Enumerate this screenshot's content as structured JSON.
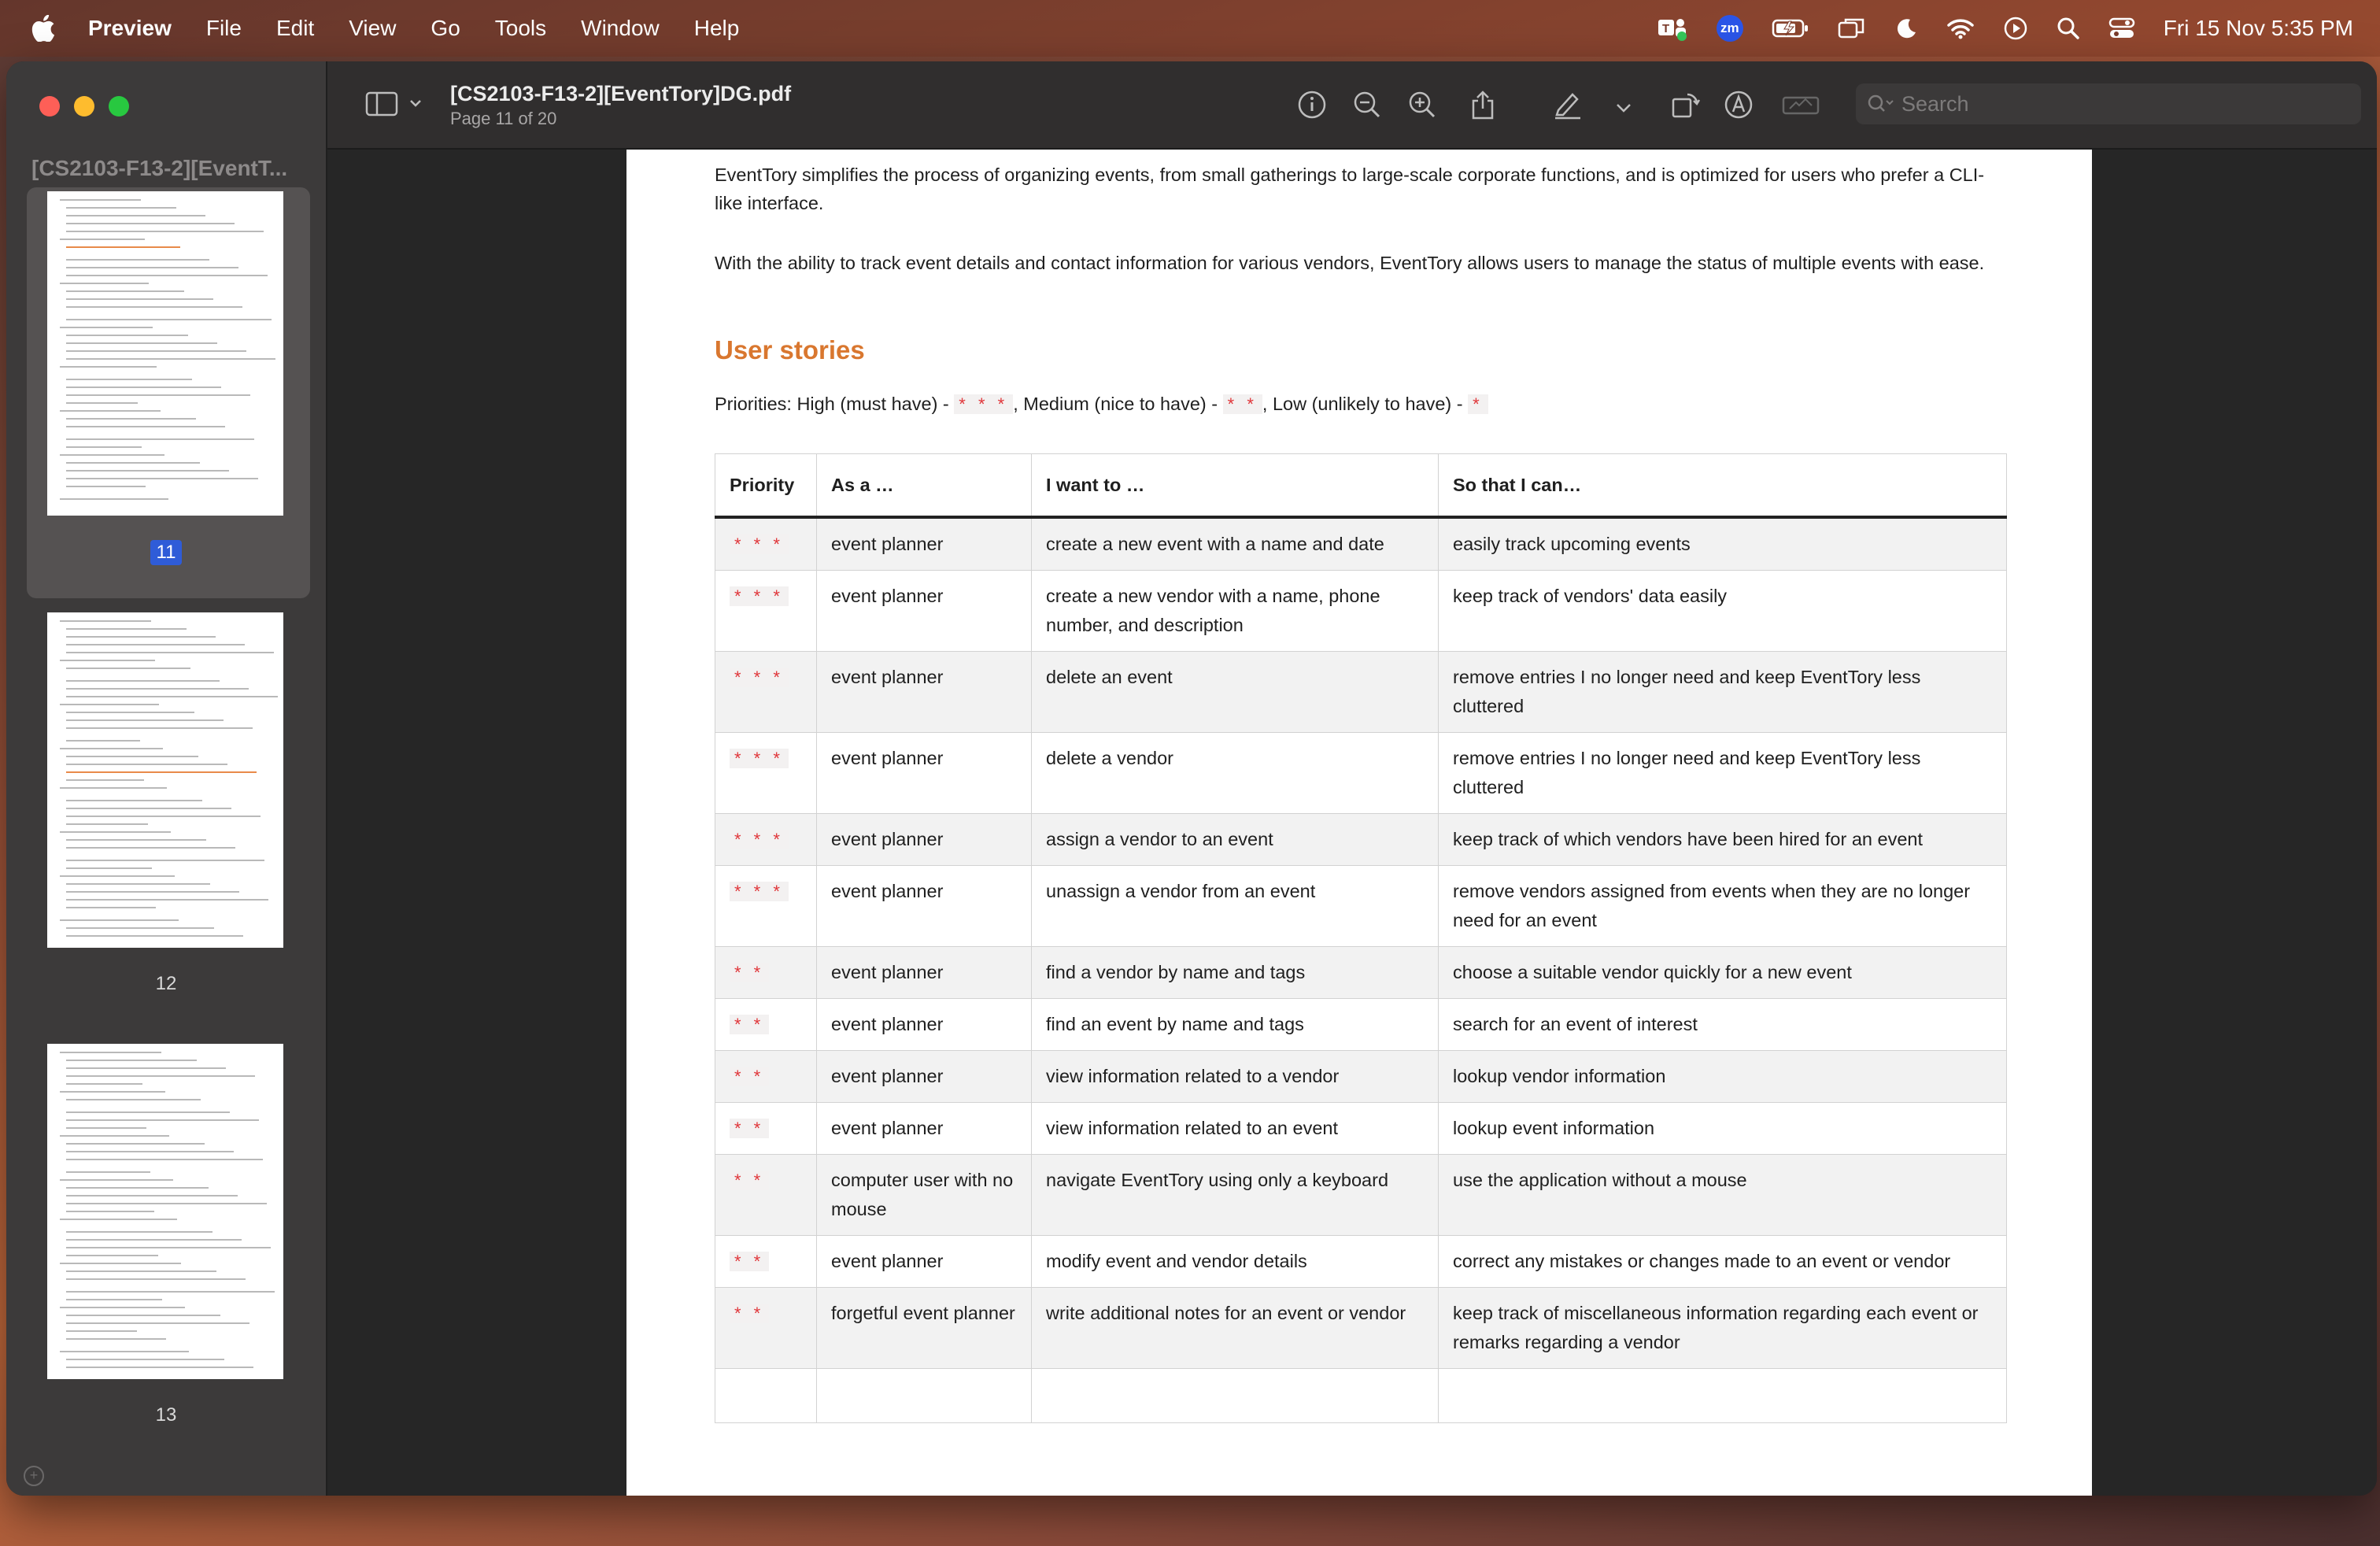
{
  "menubar": {
    "app_name": "Preview",
    "items": [
      "File",
      "Edit",
      "View",
      "Go",
      "Tools",
      "Window",
      "Help"
    ],
    "zoom_label": "zm",
    "datetime": "Fri 15 Nov  5:35 PM"
  },
  "window": {
    "sidebar_title": "[CS2103-F13-2][EventT...",
    "doc_title": "[CS2103-F13-2][EventTory]DG.pdf",
    "page_info": "Page 11 of 20",
    "search_placeholder": "Search",
    "thumbnails": [
      {
        "page": "11",
        "selected": true
      },
      {
        "page": "12",
        "selected": false
      },
      {
        "page": "13",
        "selected": false
      }
    ]
  },
  "document": {
    "para1": "EventTory simplifies the process of organizing events, from small gatherings to large-scale corporate functions, and is optimized for users who prefer a CLI-like interface.",
    "para2": "With the ability to track event details and contact information for various vendors, EventTory allows users to manage the status of multiple events with ease.",
    "heading": "User stories",
    "priorities": {
      "prefix": "Priorities: High (must have) - ",
      "high_stars": "* * *",
      "medium_text": ", Medium (nice to have) - ",
      "medium_stars": "* *",
      "low_text": ", Low (unlikely to have) - ",
      "low_stars": "*"
    },
    "table": {
      "headers": [
        "Priority",
        "As a …",
        "I want to …",
        "So that I can…"
      ],
      "rows": [
        [
          "* * *",
          "event planner",
          "create a new event with a name and date",
          "easily track upcoming events"
        ],
        [
          "* * *",
          "event planner",
          "create a new vendor with a name, phone number, and description",
          "keep track of vendors' data easily"
        ],
        [
          "* * *",
          "event planner",
          "delete an event",
          "remove entries I no longer need and keep EventTory less cluttered"
        ],
        [
          "* * *",
          "event planner",
          "delete a vendor",
          "remove entries I no longer need and keep EventTory less cluttered"
        ],
        [
          "* * *",
          "event planner",
          "assign a vendor to an event",
          "keep track of which vendors have been hired for an event"
        ],
        [
          "* * *",
          "event planner",
          "unassign a vendor from an event",
          "remove vendors assigned from events when they are no longer need for an event"
        ],
        [
          "* *",
          "event planner",
          "find a vendor by name and tags",
          "choose a suitable vendor quickly for a new event"
        ],
        [
          "* *",
          "event planner",
          "find an event by name and tags",
          "search for an event of interest"
        ],
        [
          "* *",
          "event planner",
          "view information related to a vendor",
          "lookup vendor information"
        ],
        [
          "* *",
          "event planner",
          "view information related to an event",
          "lookup event information"
        ],
        [
          "* *",
          "computer user with no mouse",
          "navigate EventTory using only a keyboard",
          "use the application without a mouse"
        ],
        [
          "* *",
          "event planner",
          "modify event and vendor details",
          "correct any mistakes or changes made to an event or vendor"
        ],
        [
          "* *",
          "forgetful event planner",
          "write additional notes for an event or vendor",
          "keep track of miscellaneous information regarding each event or remarks regarding a vendor"
        ],
        [
          "",
          "",
          "",
          ""
        ]
      ]
    }
  },
  "colors": {
    "accent_heading": "#d9772f",
    "star_red": "#e0363a",
    "selection_blue": "#2f5cd8"
  }
}
